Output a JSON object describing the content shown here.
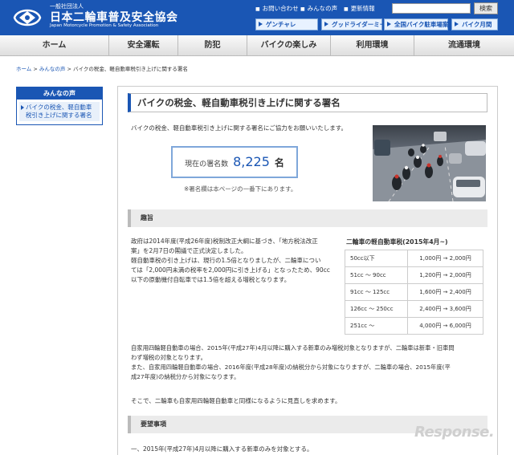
{
  "header": {
    "org_sub": "一般社団法人",
    "org_name": "日本二輪車普及安全協会",
    "org_en": "Japan Motorcycle Promotion & Safety Association",
    "top_links": [
      "お問い合わせ",
      "みんなの声",
      "更新情報"
    ],
    "search_btn": "検索",
    "banners": [
      "ゲンチャレ",
      "グッドライダーミーティング",
      "全国バイク駐車場案内",
      "バイク月間"
    ]
  },
  "nav": [
    "ホーム",
    "安全運転",
    "防犯",
    "バイクの楽しみ",
    "利用環境",
    "流通環境"
  ],
  "breadcrumb": {
    "home": "ホーム",
    "parent": "みんなの声",
    "current": "バイクの税金、軽自動車税引き上げに関する署名"
  },
  "side": {
    "title": "みんなの声",
    "item": "バイクの税金、軽自動車税引き上げに関する署名"
  },
  "main": {
    "title": "バイクの税金、軽自動車税引き上げに関する署名",
    "intro": "バイクの税金、軽自動車税引き上げに関する署名にご協力をお願いいたします。",
    "count_label": "現在の署名数",
    "count_value": "8,225",
    "count_unit": "名",
    "note": "※署名欄は本ページの一番下にあります。",
    "sec1": "趣旨",
    "p1": [
      "政府は2014年度(平成26年度)税制改正大綱に基づき、「地方税法改正",
      "案」を2月7日の閣議で正式決定しました。",
      "軽自動車税の引き上げは、現行の1.5倍となりましたが、二輪車につい",
      "ては「2,000円未満の税率を2,000円に引き上げる」となったため、90cc",
      "以下の原動機付自転車では1.5倍を超える増税となります。"
    ],
    "p2": [
      "自家用四輪軽自動車の場合、2015年(平成27年)4月以降に購入する新車のみ増税対象となりますが、二輪車は新車・旧車問",
      "わず増税の対象となります。",
      "また、自家用四輪軽自動車の場合、2016年度(平成28年度)の納税分から対象になりますが、二輪車の場合、2015年度(平",
      "成27年度)の納税分から対象になります。"
    ],
    "p3": "そこで、二輪車も自家用四輪軽自動車と同様になるように見直しを求めます。",
    "sec2": "要望事項",
    "p4": "一、2015年(平成27年)4月以降に購入する新車のみを対象とする。"
  },
  "tax_table": {
    "title": "二輪車の軽自動車税(2015年4月~)",
    "rows": [
      {
        "cls": "50cc以下",
        "val": "1,000円 → 2,000円"
      },
      {
        "cls": "51cc ～ 90cc",
        "val": "1,200円 → 2,000円"
      },
      {
        "cls": "91cc ～ 125cc",
        "val": "1,600円 → 2,400円"
      },
      {
        "cls": "126cc ～ 250cc",
        "val": "2,400円 → 3,600円"
      },
      {
        "cls": "251cc ～",
        "val": "4,000円 → 6,000円"
      }
    ]
  },
  "watermark": "Response."
}
